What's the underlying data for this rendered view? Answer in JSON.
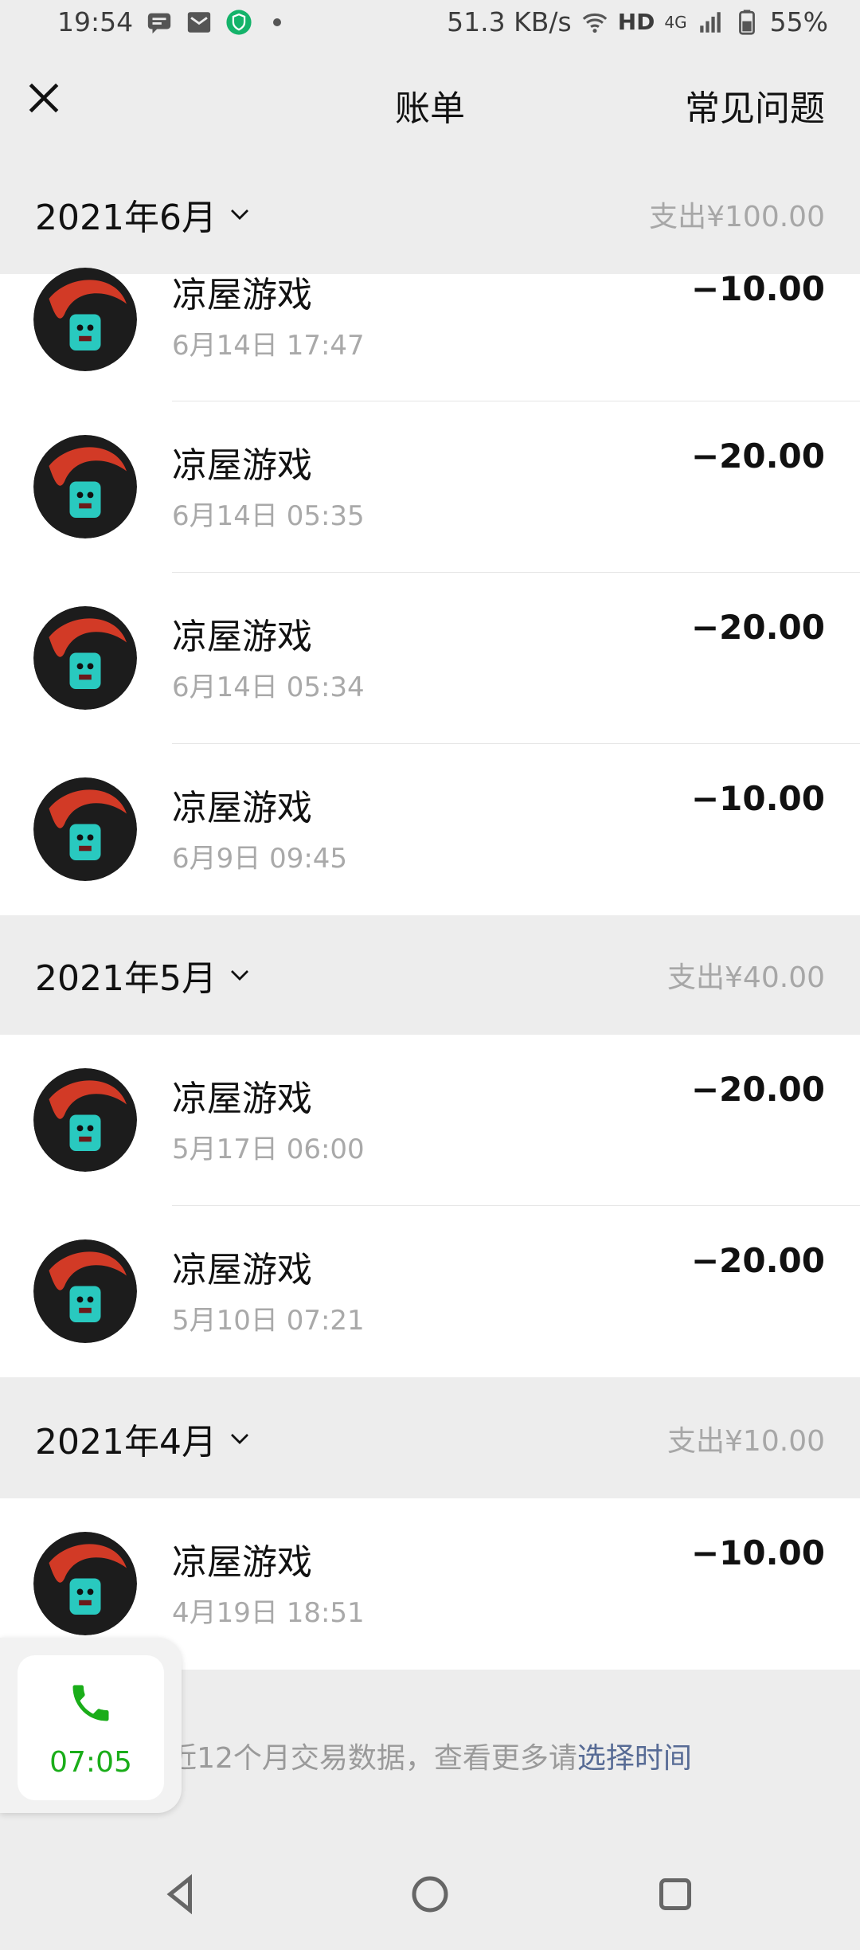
{
  "status_bar": {
    "time": "19:54",
    "speed": "51.3 KB/s",
    "hd": "HD",
    "network": "4G",
    "battery": "55%"
  },
  "header": {
    "title": "账单",
    "faq_label": "常见问题"
  },
  "months": [
    {
      "label": "2021年6月",
      "spend": "支出¥100.00"
    },
    {
      "label": "2021年5月",
      "spend": "支出¥40.00"
    },
    {
      "label": "2021年4月",
      "spend": "支出¥10.00"
    }
  ],
  "transactions": [
    {
      "name": "凉屋游戏",
      "date": "6月14日 17:47",
      "amount": "−10.00"
    },
    {
      "name": "凉屋游戏",
      "date": "6月14日 05:35",
      "amount": "−20.00"
    },
    {
      "name": "凉屋游戏",
      "date": "6月14日 05:34",
      "amount": "−20.00"
    },
    {
      "name": "凉屋游戏",
      "date": "6月9日 09:45",
      "amount": "−10.00"
    },
    {
      "name": "凉屋游戏",
      "date": "5月17日 06:00",
      "amount": "−20.00"
    },
    {
      "name": "凉屋游戏",
      "date": "5月10日 07:21",
      "amount": "−20.00"
    },
    {
      "name": "凉屋游戏",
      "date": "4月19日 18:51",
      "amount": "−10.00"
    }
  ],
  "footer": {
    "note": "近12个月交易数据，查看更多请",
    "link": "选择时间"
  },
  "call_widget": {
    "time": "07:05"
  },
  "colors": {
    "background": "#ededed",
    "row_bg": "#ffffff",
    "link": "#576b95",
    "call_green": "#1aad19"
  }
}
